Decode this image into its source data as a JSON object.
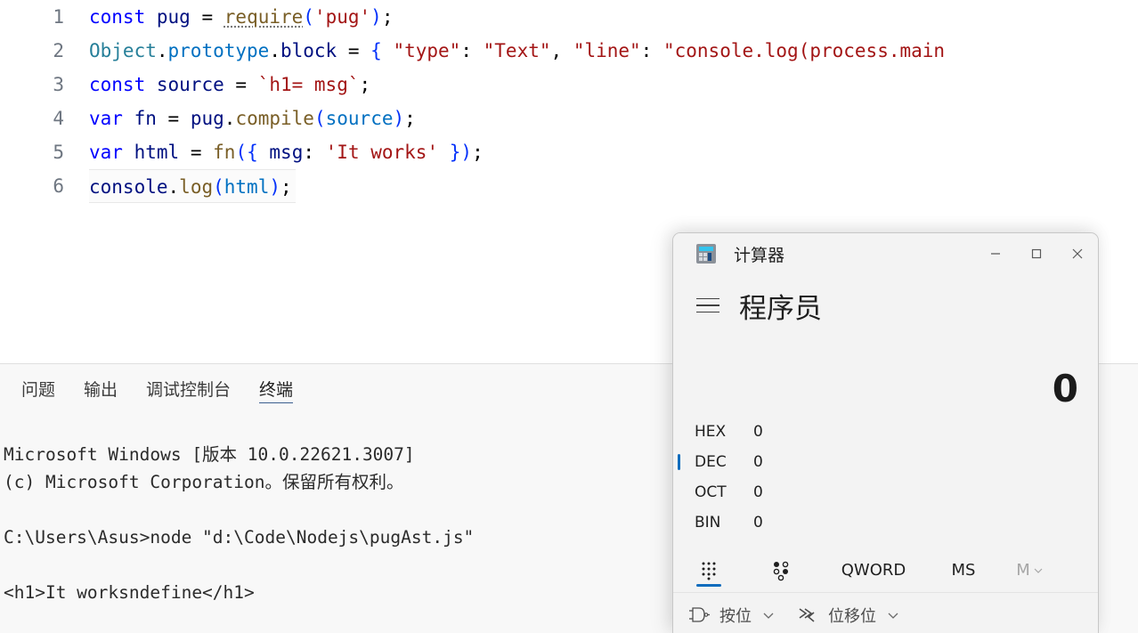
{
  "editor": {
    "lines": [
      {
        "num": "1",
        "active": false,
        "tokens": [
          {
            "t": "const",
            "c": "kw"
          },
          {
            "t": " ",
            "c": "punc"
          },
          {
            "t": "pug",
            "c": "var"
          },
          {
            "t": " ",
            "c": "punc"
          },
          {
            "t": "=",
            "c": "punc"
          },
          {
            "t": " ",
            "c": "punc"
          },
          {
            "t": "require",
            "c": "fn",
            "squiggle": true
          },
          {
            "t": "(",
            "c": "paren"
          },
          {
            "t": "'pug'",
            "c": "str"
          },
          {
            "t": ")",
            "c": "paren"
          },
          {
            "t": ";",
            "c": "punc"
          }
        ]
      },
      {
        "num": "2",
        "active": false,
        "tokens": [
          {
            "t": "Object",
            "c": "class"
          },
          {
            "t": ".",
            "c": "punc"
          },
          {
            "t": "prototype",
            "c": "prop"
          },
          {
            "t": ".",
            "c": "punc"
          },
          {
            "t": "block",
            "c": "var"
          },
          {
            "t": " ",
            "c": "punc"
          },
          {
            "t": "=",
            "c": "punc"
          },
          {
            "t": " ",
            "c": "punc"
          },
          {
            "t": "{",
            "c": "brace"
          },
          {
            "t": " ",
            "c": "punc"
          },
          {
            "t": "\"type\"",
            "c": "str"
          },
          {
            "t": ":",
            "c": "punc"
          },
          {
            "t": " ",
            "c": "punc"
          },
          {
            "t": "\"Text\"",
            "c": "str"
          },
          {
            "t": ",",
            "c": "punc"
          },
          {
            "t": " ",
            "c": "punc"
          },
          {
            "t": "\"line\"",
            "c": "str"
          },
          {
            "t": ":",
            "c": "punc"
          },
          {
            "t": " ",
            "c": "punc"
          },
          {
            "t": "\"console.log(process.main",
            "c": "str"
          }
        ]
      },
      {
        "num": "3",
        "active": false,
        "tokens": [
          {
            "t": "const",
            "c": "kw"
          },
          {
            "t": " ",
            "c": "punc"
          },
          {
            "t": "source",
            "c": "var"
          },
          {
            "t": " ",
            "c": "punc"
          },
          {
            "t": "=",
            "c": "punc"
          },
          {
            "t": " ",
            "c": "punc"
          },
          {
            "t": "`h1= msg`",
            "c": "str"
          },
          {
            "t": ";",
            "c": "punc"
          }
        ]
      },
      {
        "num": "4",
        "active": false,
        "tokens": [
          {
            "t": "var",
            "c": "kw"
          },
          {
            "t": " ",
            "c": "punc"
          },
          {
            "t": "fn",
            "c": "var"
          },
          {
            "t": " ",
            "c": "punc"
          },
          {
            "t": "=",
            "c": "punc"
          },
          {
            "t": " ",
            "c": "punc"
          },
          {
            "t": "pug",
            "c": "var"
          },
          {
            "t": ".",
            "c": "punc"
          },
          {
            "t": "compile",
            "c": "fn"
          },
          {
            "t": "(",
            "c": "paren"
          },
          {
            "t": "source",
            "c": "prop"
          },
          {
            "t": ")",
            "c": "paren"
          },
          {
            "t": ";",
            "c": "punc"
          }
        ]
      },
      {
        "num": "5",
        "active": false,
        "tokens": [
          {
            "t": "var",
            "c": "kw"
          },
          {
            "t": " ",
            "c": "punc"
          },
          {
            "t": "html",
            "c": "var"
          },
          {
            "t": " ",
            "c": "punc"
          },
          {
            "t": "=",
            "c": "punc"
          },
          {
            "t": " ",
            "c": "punc"
          },
          {
            "t": "fn",
            "c": "fn"
          },
          {
            "t": "(",
            "c": "paren"
          },
          {
            "t": "{",
            "c": "brace"
          },
          {
            "t": " ",
            "c": "punc"
          },
          {
            "t": "msg",
            "c": "var"
          },
          {
            "t": ":",
            "c": "punc"
          },
          {
            "t": " ",
            "c": "punc"
          },
          {
            "t": "'It works'",
            "c": "str"
          },
          {
            "t": " ",
            "c": "punc"
          },
          {
            "t": "}",
            "c": "brace"
          },
          {
            "t": ")",
            "c": "paren"
          },
          {
            "t": ";",
            "c": "punc"
          }
        ]
      },
      {
        "num": "6",
        "active": true,
        "tokens": [
          {
            "t": "console",
            "c": "var"
          },
          {
            "t": ".",
            "c": "punc"
          },
          {
            "t": "log",
            "c": "fn"
          },
          {
            "t": "(",
            "c": "paren"
          },
          {
            "t": "html",
            "c": "prop"
          },
          {
            "t": ")",
            "c": "paren"
          },
          {
            "t": ";",
            "c": "punc"
          }
        ]
      }
    ]
  },
  "panel": {
    "tabs": [
      {
        "label": "问题",
        "active": false
      },
      {
        "label": "输出",
        "active": false
      },
      {
        "label": "调试控制台",
        "active": false
      },
      {
        "label": "终端",
        "active": true
      }
    ],
    "terminal_lines": [
      "Microsoft Windows [版本 10.0.22621.3007]",
      "(c) Microsoft Corporation。保留所有权利。",
      "",
      "C:\\Users\\Asus>node \"d:\\Code\\Nodejs\\pugAst.js\"",
      "",
      "<h1>It worksndefine</h1>"
    ]
  },
  "calculator": {
    "title": "计算器",
    "window_buttons": {
      "minimize": "最小化",
      "maximize": "最大化",
      "close": "关闭"
    },
    "mode": "程序员",
    "display_value": "0",
    "bases": [
      {
        "label": "HEX",
        "value": "0",
        "selected": false
      },
      {
        "label": "DEC",
        "value": "0",
        "selected": true
      },
      {
        "label": "OCT",
        "value": "0",
        "selected": false
      },
      {
        "label": "BIN",
        "value": "0",
        "selected": false
      }
    ],
    "toolbar": {
      "keypad_label": "键盘",
      "bit_toggle_label": "按位切换键盘",
      "qword": "QWORD",
      "ms": "MS",
      "m": "M"
    },
    "bottom": {
      "bitwise": "按位",
      "bitshift": "位移位"
    },
    "accent": "#0f6cbd"
  }
}
